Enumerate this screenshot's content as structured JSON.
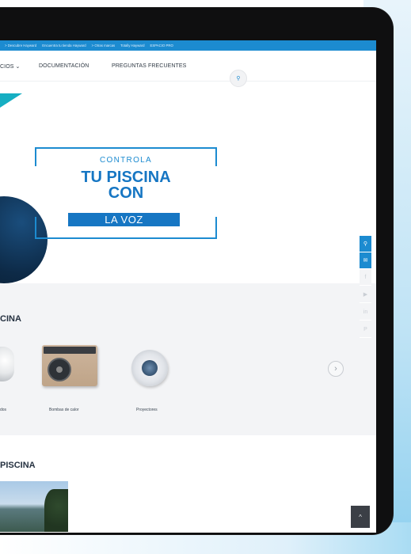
{
  "topbar": {
    "links": [
      "> Descubre Hayward",
      "Encuentra tu tienda Hayward",
      "> Otras marcas",
      "Totally Hayward",
      "ESPACIO PRO"
    ]
  },
  "nav": {
    "items": [
      {
        "label": "CIOS",
        "dropdown": true
      },
      {
        "label": "DOCUMENTACIÓN"
      },
      {
        "label": "PREGUNTAS FRECUENTES"
      }
    ],
    "search_icon": "search-icon"
  },
  "hero": {
    "small": "CONTROLA",
    "big_line1": "TU PISCINA",
    "big_line2": "CON",
    "band": "LA VOZ"
  },
  "side_social": [
    {
      "icon": "location-pin-icon",
      "glyph": "⚲",
      "active": true
    },
    {
      "icon": "mail-icon",
      "glyph": "✉",
      "active": true
    },
    {
      "icon": "facebook-icon",
      "glyph": "f",
      "active": false
    },
    {
      "icon": "youtube-icon",
      "glyph": "▶",
      "active": false
    },
    {
      "icon": "linkedin-icon",
      "glyph": "in",
      "active": false
    },
    {
      "icon": "pinterest-icon",
      "glyph": "P",
      "active": false
    }
  ],
  "products": {
    "title": "CINA",
    "items": [
      {
        "label": "dos"
      },
      {
        "label": "Bombas de calor"
      },
      {
        "label": "Proyectores"
      }
    ],
    "next_icon": "›"
  },
  "section2": {
    "title": "PISCINA"
  },
  "scroll_top_icon": "^",
  "colors": {
    "brand_blue": "#1c8bd0",
    "dark_blue": "#1676c3",
    "teal": "#16aec2"
  }
}
